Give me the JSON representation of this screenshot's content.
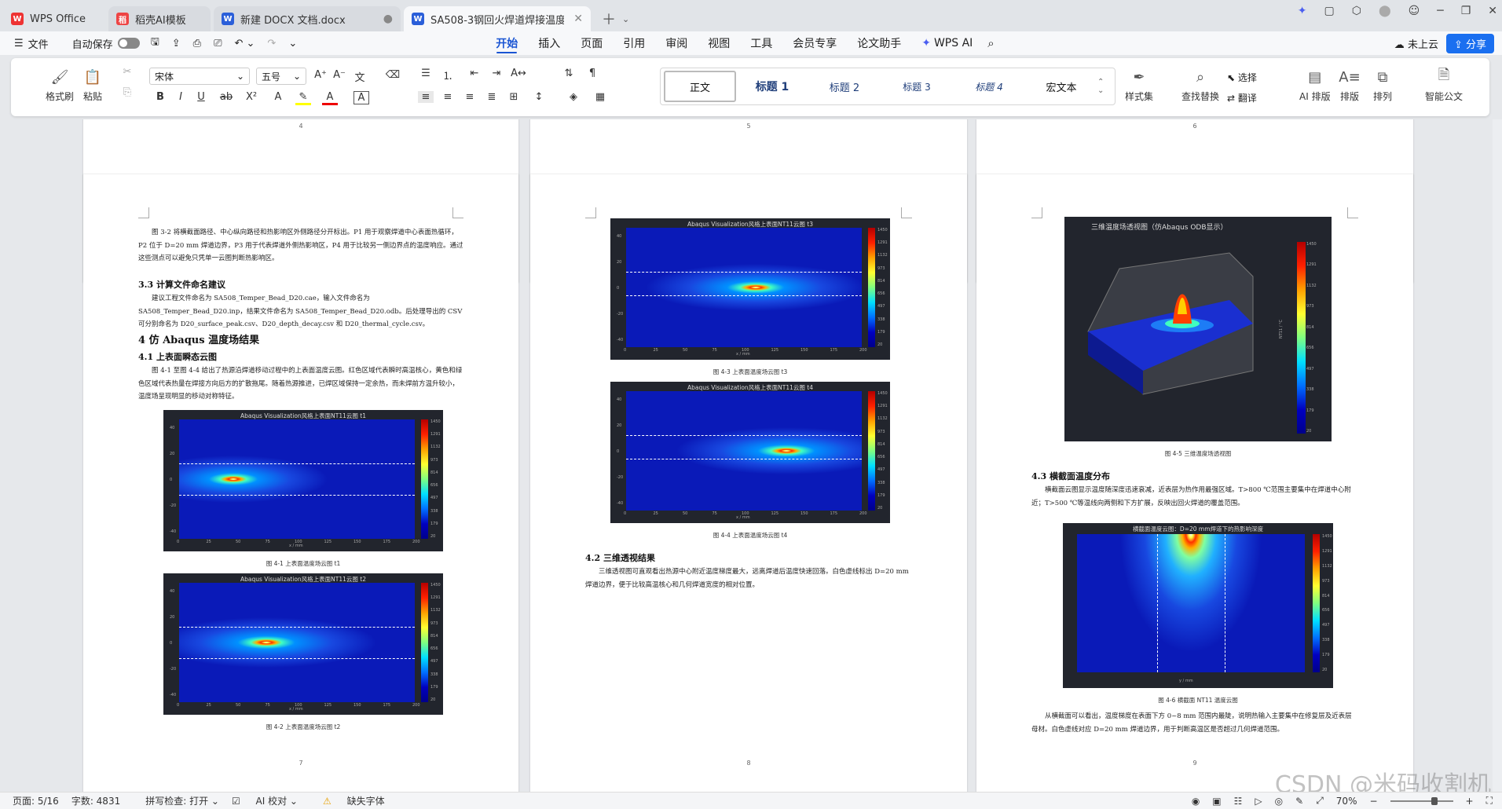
{
  "tabs": [
    {
      "label": "WPS Office",
      "icon": "wps-logo-icon"
    },
    {
      "label": "稻壳AI模板",
      "icon": "docer-icon"
    },
    {
      "label": "新建 DOCX 文档.docx",
      "icon": "word-doc-icon"
    },
    {
      "label": "SA508-3钢回火焊道焊接温度",
      "icon": "word-doc-icon"
    }
  ],
  "menubar": {
    "file": "文件",
    "autosave": "自动保存",
    "tabs": [
      "开始",
      "插入",
      "页面",
      "引用",
      "审阅",
      "视图",
      "工具",
      "会员专享",
      "论文助手",
      "WPS AI"
    ],
    "cloud": "未上云",
    "share": "分享"
  },
  "ribbon": {
    "format_brush": "格式刷",
    "paste": "粘贴",
    "font": "宋体",
    "size": "五号",
    "styles": [
      "正文",
      "标题 1",
      "标题 2",
      "标题 3",
      "标题 4",
      "宏文本"
    ],
    "style_set": "样式集",
    "find_replace": "查找替换",
    "select": "选择",
    "translate": "翻译",
    "ai_layout": "AI 排版",
    "layout": "排版",
    "arrange": "排列",
    "smart_doc": "智能公文"
  },
  "pages_top": [
    "4",
    "5",
    "6"
  ],
  "page7": {
    "para1": "图 3-2 将横截面路径、中心纵向路径和热影响区外侧路径分开标出。P1 用于观察焊道中心表面热循环，P2 位于 D=20 mm 焊道边界，P3 用于代表焊道外侧热影响区，P4 用于比较另一侧边界点的温度响应。通过这些测点可以避免只凭单一云图判断热影响区。",
    "h33": "3.3  计算文件命名建议",
    "para2": "建议工程文件命名为 SA508_Temper_Bead_D20.cae，输入文件命名为 SA508_Temper_Bead_D20.inp，结果文件命名为 SA508_Temper_Bead_D20.odb。后处理导出的 CSV 可分别命名为 D20_surface_peak.csv、D20_depth_decay.csv 和 D20_thermal_cycle.csv。",
    "h4": "4  仿 Abaqus 温度场结果",
    "h41": "4.1  上表面瞬态云图",
    "para3": "图 4-1 至图 4-4 给出了热源沿焊道移动过程中的上表面温度云图。红色区域代表瞬时高温核心，黄色和绿色区域代表热量在焊接方向后方的扩散拖尾。随着热源推进，已焊区域保持一定余热，而未焊前方温升较小，温度场呈现明显的移动对称特征。",
    "fig1_title": "Abaqus Visualization风格上表面NT11云图 t1",
    "fig1_cap": "图 4-1  上表面温度场云图 t1",
    "fig2_title": "Abaqus Visualization风格上表面NT11云图 t2",
    "fig2_cap": "图 4-2  上表面温度场云图 t2",
    "num": "7"
  },
  "page8": {
    "fig3_title": "Abaqus Visualization风格上表面NT11云图 t3",
    "fig3_cap": "图 4-3  上表面温度场云图 t3",
    "fig4_title": "Abaqus Visualization风格上表面NT11云图 t4",
    "fig4_cap": "图 4-4  上表面温度场云图 t4",
    "h42": "4.2  三维透视结果",
    "para4": "三维透视图可直观看出热源中心附近温度梯度最大，远离焊道后温度快速回落。白色虚线标出 D=20 mm 焊道边界，便于比较高温核心和几何焊道宽度的相对位置。",
    "num": "8"
  },
  "page9": {
    "fig5_title": "三维温度场透视图（仿Abaqus ODB显示）",
    "fig5_cap": "图 4-5  三维温度场透视图",
    "fig5_clabel": "NT11 / °C",
    "h43": "4.3  横截面温度分布",
    "para5": "横截面云图显示温度随深度迅速衰减，近表层为热作用最强区域。T>800 ℃范围主要集中在焊道中心附近；T>500 ℃等温线向两侧和下方扩展，反映出回火焊道的覆盖范围。",
    "fig6_title": "横截面温度云图：D=20 mm焊道下的热影响深度",
    "fig6_cap": "图 4-6  横截面 NT11 温度云图",
    "para6": "从横截面可以看出，温度梯度在表面下方 0~8 mm 范围内最陡，说明热输入主要集中在修复层及近表层母材。白色虚线对应 D=20 mm 焊道边界，用于判断高温区是否超过几何焊道范围。",
    "num": "9"
  },
  "colorbar_ticks": [
    "1450",
    "1291",
    "1132",
    "973",
    "814",
    "656",
    "497",
    "338",
    "179",
    "20"
  ],
  "colorbar_label": "NT11 / °C",
  "xaxis_ticks": [
    "0",
    "25",
    "50",
    "75",
    "100",
    "125",
    "150",
    "175",
    "200"
  ],
  "xaxis_label": "x / mm",
  "yaxis_label": "y / mm",
  "yaxis_ticks": [
    "40",
    "20",
    "0",
    "-20",
    "-40"
  ],
  "status": {
    "page": "页面: 5/16",
    "words": "字数: 4831",
    "spell": "拼写检查: 打开",
    "ai": "AI 校对",
    "font_missing": "缺失字体",
    "zoom": "70%"
  },
  "watermark": "CSDN @米码收割机"
}
